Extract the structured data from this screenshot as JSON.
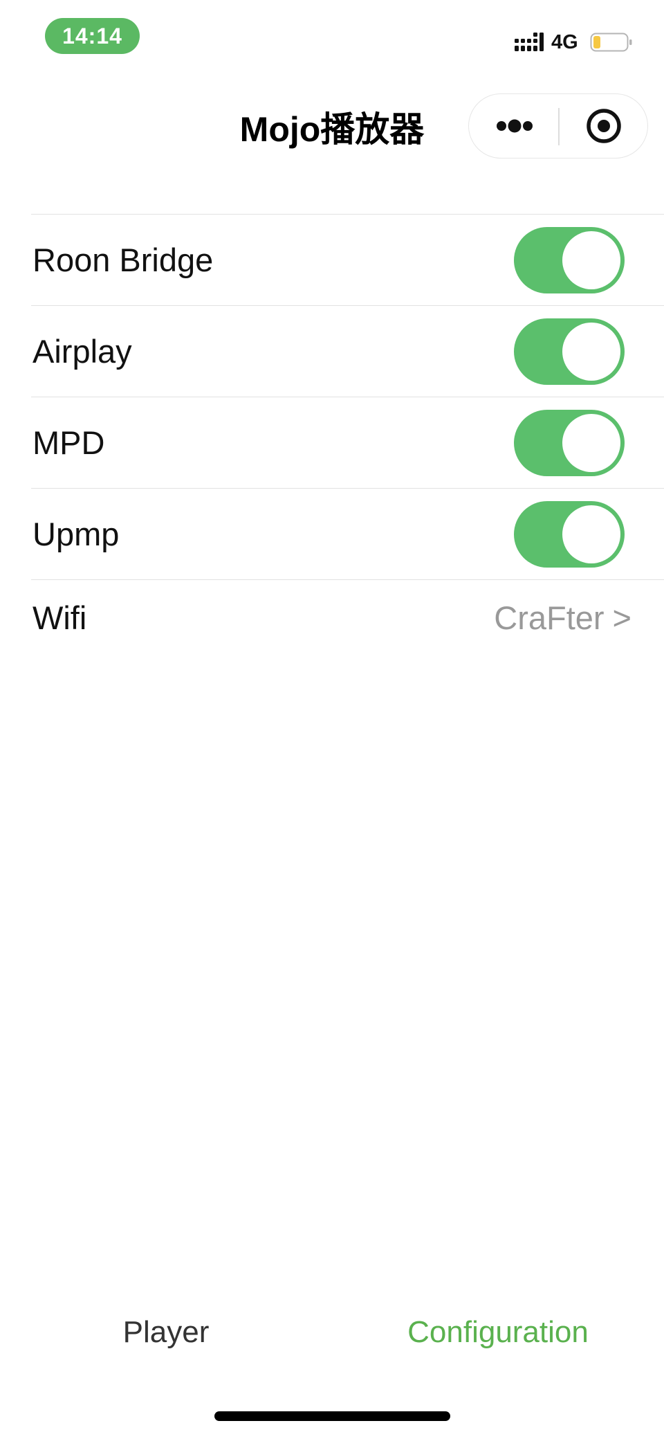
{
  "status_bar": {
    "time": "14:14",
    "network": "4G",
    "signal_icon": "signal-bars-icon",
    "battery_icon": "battery-low-icon",
    "time_pill_color": "#5bb963",
    "battery_fill_color": "#f6c843"
  },
  "nav": {
    "title": "Mojo播放器",
    "more_icon": "more-dots-icon",
    "close_icon": "target-circle-icon"
  },
  "settings": {
    "items": [
      {
        "label": "Roon Bridge",
        "enabled": true
      },
      {
        "label": "Airplay",
        "enabled": true
      },
      {
        "label": "MPD",
        "enabled": true
      },
      {
        "label": "Upmp",
        "enabled": true
      }
    ],
    "wifi": {
      "label": "Wifi",
      "value": "CraFter",
      "chevron": ">"
    }
  },
  "tabs": {
    "player": "Player",
    "configuration": "Configuration",
    "active": "configuration"
  },
  "colors": {
    "toggle_on": "#5bbf6c",
    "active_tab": "#5ab14e",
    "secondary_text": "#999999"
  }
}
